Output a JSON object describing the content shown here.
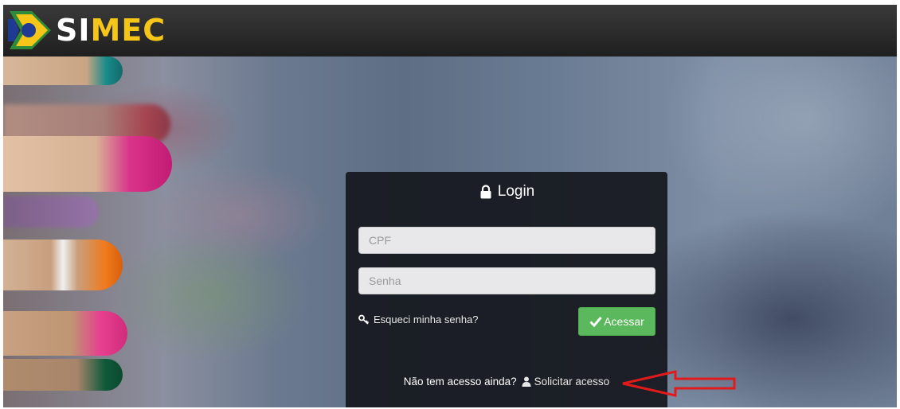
{
  "header": {
    "logo_text_si": "SI",
    "logo_text_mec": "MEC",
    "logo_colors": {
      "si": "#ffffff",
      "mec": "#f5c518",
      "flag_green": "#2e8b3a",
      "flag_yellow": "#f5c518",
      "flag_blue": "#1f3a93"
    }
  },
  "login": {
    "title": "Login",
    "title_icon": "lock-icon",
    "cpf_placeholder": "CPF",
    "senha_placeholder": "Senha",
    "forgot_label": "Esqueci minha senha?",
    "forgot_icon": "key-icon",
    "submit_label": "Acessar",
    "submit_icon": "check-icon",
    "submit_color": "#5cb85c",
    "request_prompt": "Não tem acesso ainda?",
    "request_link_label": "Solicitar acesso",
    "request_icon": "user-icon"
  },
  "annotation": {
    "arrow_icon": "red-arrow-icon",
    "arrow_color": "#e01b1b"
  }
}
